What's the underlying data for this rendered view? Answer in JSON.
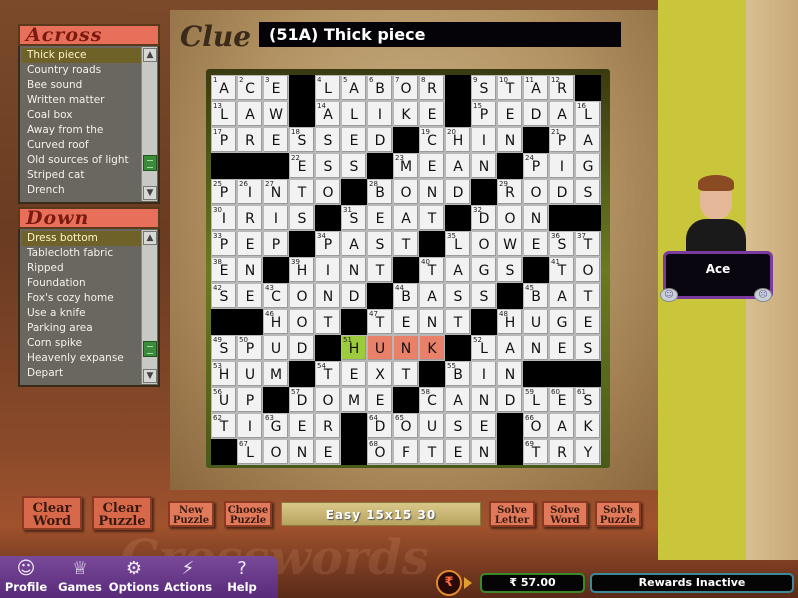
{
  "across": {
    "title": "Across",
    "items": [
      "Thick piece",
      "Country roads",
      "Bee sound",
      "Written matter",
      "Coal box",
      "Away from the",
      "Curved roof",
      "Old sources of light",
      "Striped cat",
      "Drench"
    ],
    "selected_index": 0,
    "scroll_fraction": 0.85
  },
  "down": {
    "title": "Down",
    "items": [
      "Dress bottom",
      "Tablecloth fabric",
      "Ripped",
      "Foundation",
      "Fox's cozy home",
      "Use a knife",
      "Parking area",
      "Corn spike",
      "Heavenly expanse",
      "Depart"
    ],
    "selected_index": 0,
    "scroll_fraction": 0.88
  },
  "clue": {
    "label": "Clue",
    "text": "(51A) Thick piece"
  },
  "grid": {
    "size": 15,
    "rows": [
      "ACE#LABOR#STAR#",
      "LAW#ALIKE#PEDAL",
      "PRESSED#CHIN#PA",
      "###ESS#MEAN#PIG",
      "PINTO#BOND#RODS",
      "IRIS#SEAT#DON##",
      "PEP#PAST#LOWEST",
      "EN#HINT#TAGS#TO",
      "SECOND#BASS#BAT",
      "##HOT#TENT#HUGE",
      "SPUD#HUNK#LANES",
      "HUM#TEXT#BIN###",
      "UP#DOME#CANDLES",
      "TIGER#DOUSE#OAK",
      "#LONE#OFTEN#TRY"
    ],
    "active_cell": [
      10,
      5
    ],
    "active_word": [
      [
        10,
        5
      ],
      [
        10,
        6
      ],
      [
        10,
        7
      ],
      [
        10,
        8
      ]
    ],
    "colors": {
      "active": "#9ccc3c",
      "word": "#e8806a"
    }
  },
  "opponent": {
    "name": "Ace",
    "happy_icon": "smiley-icon",
    "sad_icon": "frown-icon"
  },
  "buttons": {
    "clear_word": "Clear Word",
    "clear_puzzle": "Clear Puzzle",
    "new_puzzle": "New Puzzle",
    "choose_puzzle": "Choose Puzzle",
    "solve_letter": "Solve Letter",
    "solve_word": "Solve Word",
    "solve_puzzle": "Solve Puzzle"
  },
  "level": "Easy 15x15 30",
  "watermark": "Crosswords",
  "nav": [
    {
      "label": "Profile",
      "icon": "profile-icon",
      "glyph": "☺"
    },
    {
      "label": "Games",
      "icon": "trophy-icon",
      "glyph": "♕"
    },
    {
      "label": "Options",
      "icon": "gear-icon",
      "glyph": "⚙"
    },
    {
      "label": "Actions",
      "icon": "lightning-icon",
      "glyph": "⚡"
    },
    {
      "label": "Help",
      "icon": "help-icon",
      "glyph": "?"
    }
  ],
  "currency": {
    "symbol": "₹",
    "balance": "₹ 57.00",
    "rewards": "Rewards Inactive"
  }
}
